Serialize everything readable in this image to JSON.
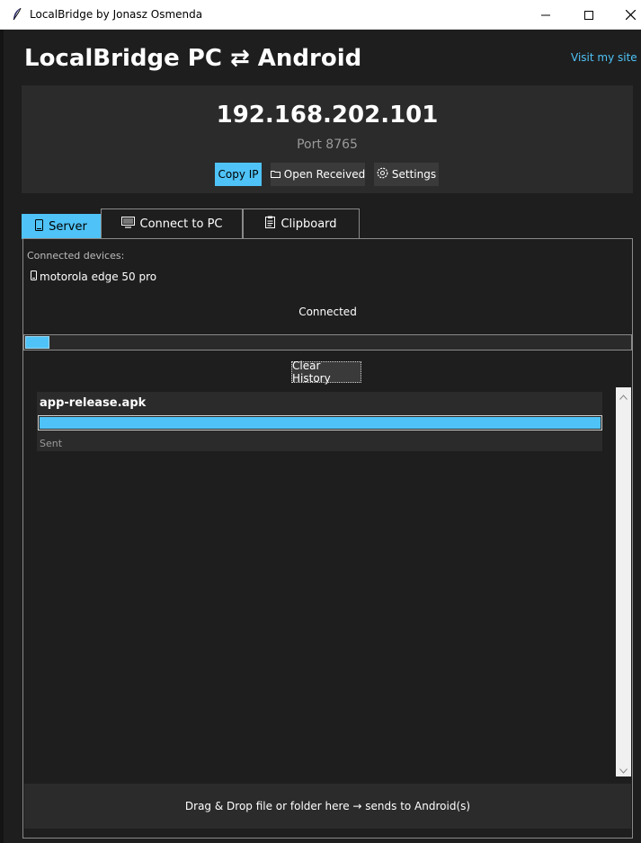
{
  "window": {
    "title": "LocalBridge by Jonasz Osmenda",
    "icons": {
      "app": "feather-icon",
      "minimize": "minimize-icon",
      "maximize": "maximize-icon",
      "close": "close-icon"
    }
  },
  "header": {
    "app_title": "LocalBridge PC ⇄ Android",
    "visit_link": "Visit my site",
    "ip": "192.168.202.101",
    "port": "Port 8765",
    "buttons": {
      "copy_ip": "Copy IP",
      "open_received": "Open Received",
      "settings": "Settings"
    }
  },
  "tabs": [
    {
      "label": "Server",
      "icon": "phone-icon",
      "active": true
    },
    {
      "label": "Connect to PC",
      "icon": "monitor-icon",
      "active": false
    },
    {
      "label": "Clipboard",
      "icon": "clipboard-icon",
      "active": false
    }
  ],
  "server": {
    "connected_label": "Connected devices:",
    "devices": [
      "motorola edge 50 pro"
    ],
    "status": "Connected",
    "progress": 0.04,
    "clear_history": "Clear History",
    "history": [
      {
        "name": "app-release.apk",
        "progress": 1.0,
        "status": "Sent"
      }
    ],
    "drop_hint": "Drag & Drop file or folder here → sends to Android(s)"
  },
  "colors": {
    "accent": "#4fc3f7",
    "background": "#1e1e1e",
    "panel": "#2b2b2b",
    "button": "#3a3a3a"
  }
}
